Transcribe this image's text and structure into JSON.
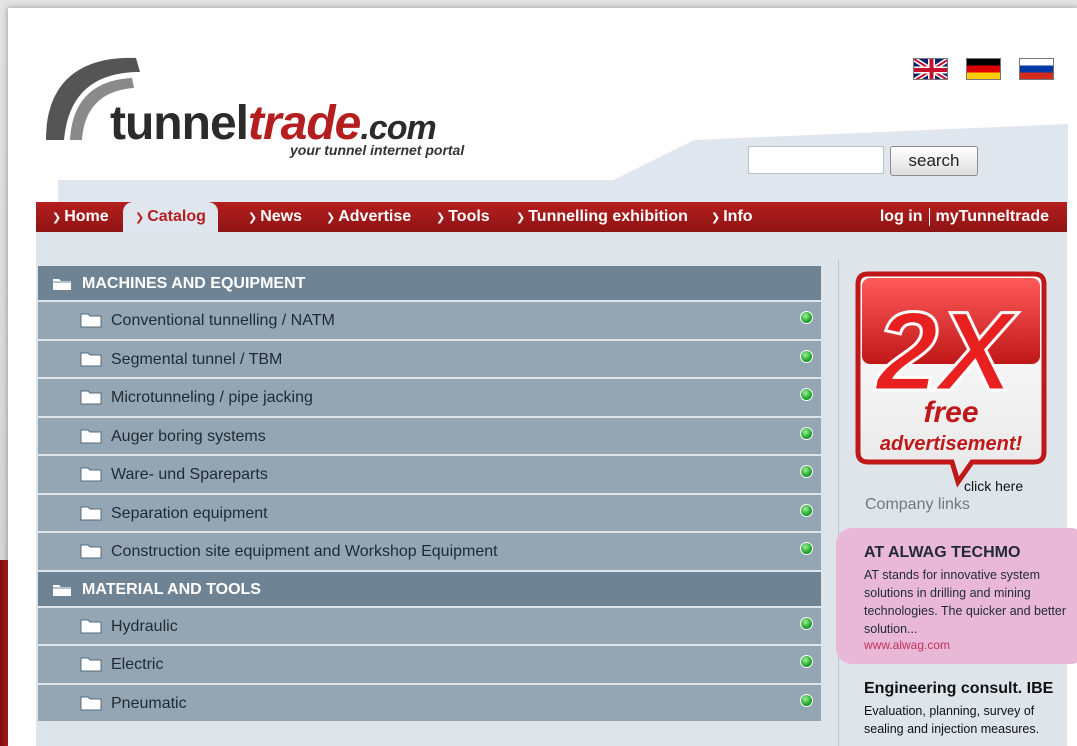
{
  "brand": {
    "name_part1": "tunnel",
    "name_part2": "trade",
    "name_part3": ".com",
    "tagline": "your tunnel internet portal"
  },
  "languages": [
    "english-flag",
    "german-flag",
    "russian-flag"
  ],
  "search": {
    "value": "",
    "placeholder": "",
    "button_label": "search"
  },
  "nav": {
    "items": [
      {
        "label": "Home",
        "active": false
      },
      {
        "label": "Catalog",
        "active": true
      },
      {
        "label": "News",
        "active": false
      },
      {
        "label": "Advertise",
        "active": false
      },
      {
        "label": "Tools",
        "active": false
      },
      {
        "label": "Tunnelling exhibition",
        "active": false
      },
      {
        "label": "Info",
        "active": false
      }
    ],
    "login_label": "log in",
    "account_label": "myTunneltrade"
  },
  "catalog": {
    "section1": {
      "title": "MACHINES AND EQUIPMENT",
      "items": [
        "Conventional tunnelling / NATM",
        "Segmental tunnel / TBM",
        "Microtunneling / pipe jacking",
        "Auger boring systems",
        "Ware- und Spareparts",
        "Separation equipment",
        "Construction site equipment and Workshop Equipment"
      ]
    },
    "section2": {
      "title": "MATERIAL AND TOOLS",
      "items": [
        "Hydraulic",
        "Electric",
        "Pneumatic"
      ]
    }
  },
  "promo": {
    "big_text": "2X",
    "line1": "free",
    "line2": "advertisement!",
    "click_label": "click here"
  },
  "sidebar": {
    "company_links_label": "Company links",
    "company1": {
      "name": "AT ALWAG TECHMO",
      "description": "AT stands for innovative system solutions in drilling and mining technologies. The quicker and better solution...",
      "url": "www.alwag.com"
    },
    "company2": {
      "name": "Engineering consult. IBE",
      "description": "Evaluation, planning, survey of sealing and injection measures."
    }
  },
  "colors": {
    "brand_red": "#b51e1e",
    "nav_bg": "#9e1919",
    "catalog_header": "#6e8494",
    "catalog_row": "#94a6b4",
    "status_green": "#1fa52b",
    "company_highlight": "#e9b8d7"
  }
}
